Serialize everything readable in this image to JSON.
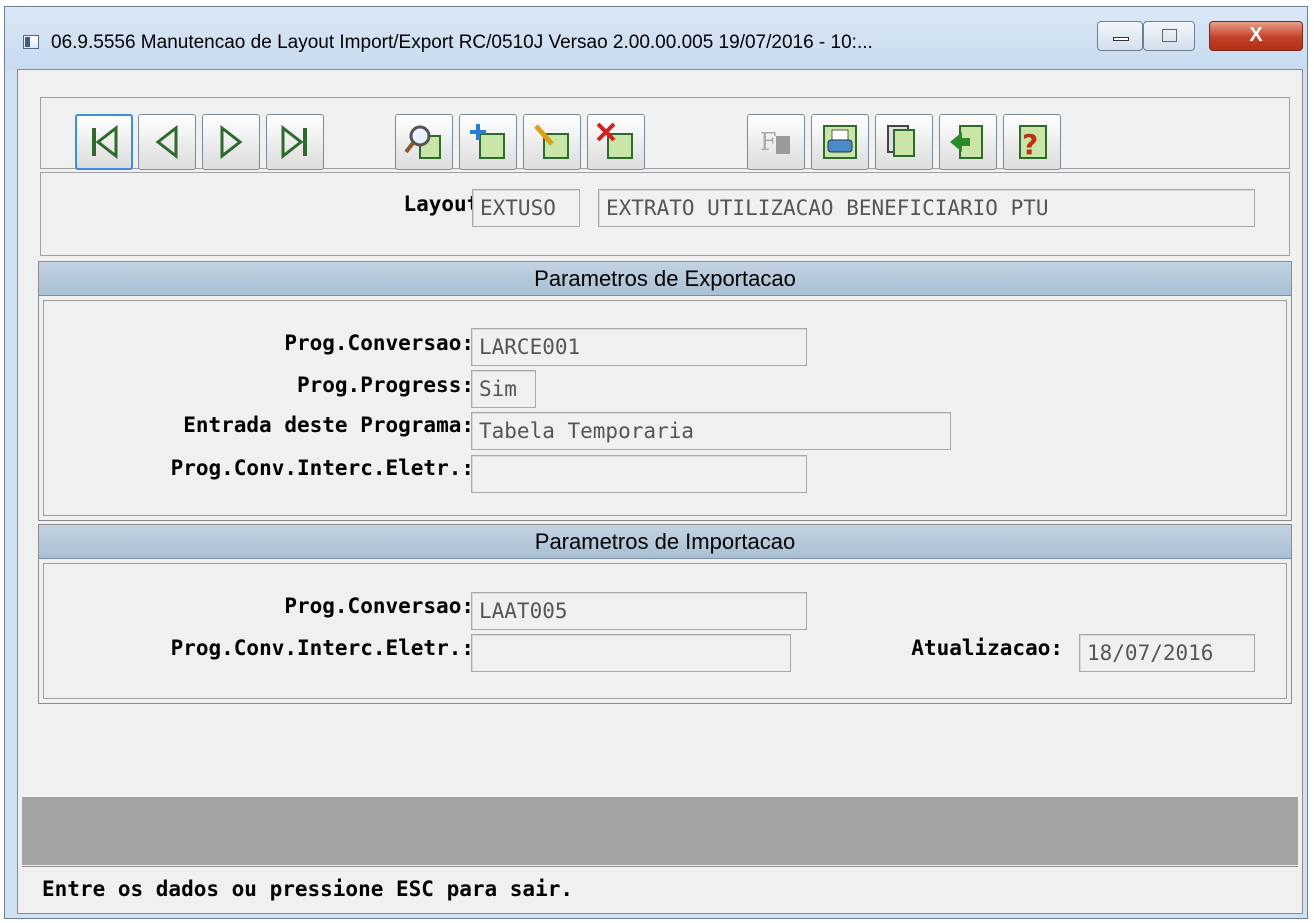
{
  "window": {
    "title": "06.9.5556 Manutencao  de Layout Import/Export RC/0510J Versao 2.00.00.005 19/07/2016 - 10:...",
    "minimize_glyph": "",
    "maximize_glyph": "",
    "close_glyph": "X"
  },
  "toolbar": {
    "buttons": [
      {
        "name": "first-record",
        "icon": "first-icon"
      },
      {
        "name": "previous-record",
        "icon": "previous-icon"
      },
      {
        "name": "next-record",
        "icon": "next-icon"
      },
      {
        "name": "last-record",
        "icon": "last-icon"
      },
      {
        "name": "search",
        "icon": "search-icon"
      },
      {
        "name": "add",
        "icon": "add-icon"
      },
      {
        "name": "edit",
        "icon": "edit-icon"
      },
      {
        "name": "delete",
        "icon": "delete-icon"
      },
      {
        "name": "filter",
        "icon": "filter-icon",
        "glyph": "F"
      },
      {
        "name": "print",
        "icon": "print-icon"
      },
      {
        "name": "copy",
        "icon": "copy-icon"
      },
      {
        "name": "exit",
        "icon": "exit-icon"
      },
      {
        "name": "help",
        "icon": "help-icon",
        "glyph": "?"
      }
    ]
  },
  "layout": {
    "label": "Layout:",
    "code": "EXTUSO",
    "description": "EXTRATO UTILIZACAO BENEFICIARIO PTU"
  },
  "export": {
    "header": "Parametros de Exportacao",
    "prog_conversao_label": "Prog.Conversao:",
    "prog_conversao_value": "LARCE001",
    "prog_progress_label": "Prog.Progress:",
    "prog_progress_value": "Sim",
    "entrada_label": "Entrada deste Programa:",
    "entrada_value": "Tabela Temporaria",
    "prog_conv_interc_label": "Prog.Conv.Interc.Eletr.:",
    "prog_conv_interc_value": ""
  },
  "import": {
    "header": "Parametros de Importacao",
    "prog_conversao_label": "Prog.Conversao:",
    "prog_conversao_value": "LAAT005",
    "prog_conv_interc_label": "Prog.Conv.Interc.Eletr.:",
    "prog_conv_interc_value": "",
    "atualizacao_label": "Atualizacao:",
    "atualizacao_value": "18/07/2016"
  },
  "status": {
    "message": "Entre os dados ou pressione ESC para sair."
  }
}
